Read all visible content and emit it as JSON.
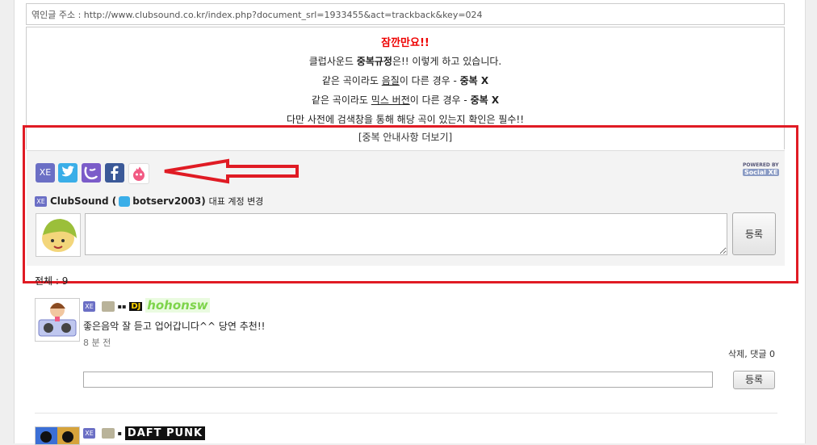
{
  "trackback": {
    "label": "엮인글 주소 : http://www.clubsound.co.kr/index.php?document_srl=1933455&act=trackback&key=024"
  },
  "notice": {
    "title": "잠깐만요!!",
    "line1_pre": "클럽사운드 ",
    "line1_bold": "중복규정",
    "line1_post": "은!! 이렇게 하고 있습니다.",
    "line2_pre": "같은 곡이라도 ",
    "line2_u": "음질",
    "line2_mid": "이 다른 경우 - ",
    "line2_bold": "중복 X",
    "line3_pre": "같은 곡이라도 ",
    "line3_u": "믹스 버전",
    "line3_mid": "이 다른 경우 - ",
    "line3_bold": "중복 X",
    "line4": "다만 사전에 검색창을 통해 해당 곡이 있는지 확인은 필수!!",
    "more_link": "[중복 안내사항 더보기]"
  },
  "social": {
    "services": [
      "XE",
      "Twitter",
      "Yozm",
      "Facebook",
      "Me2day"
    ],
    "powered_by": "POWERED BY",
    "powered_name": "Social XE",
    "account_site": "ClubSound (",
    "account_user": "botserv2003)",
    "account_change": "대표 계정 변경",
    "submit_label": "등록"
  },
  "comments": {
    "total_label": "전체 : 9",
    "items": [
      {
        "nickname": "hohonsw",
        "badge": "DJ",
        "text": "좋은음악 잘 듣고 업어갑니다^^ 당연 추천!!",
        "time": "8 분 전",
        "actions": "삭제, 댓글 0",
        "reply_submit": "등록"
      },
      {
        "badge_text": "DAFT PUNK"
      }
    ]
  },
  "colors": {
    "highlight_box": "#e01b24",
    "notice_title": "#e00000",
    "nickname": "#7ed44b"
  }
}
